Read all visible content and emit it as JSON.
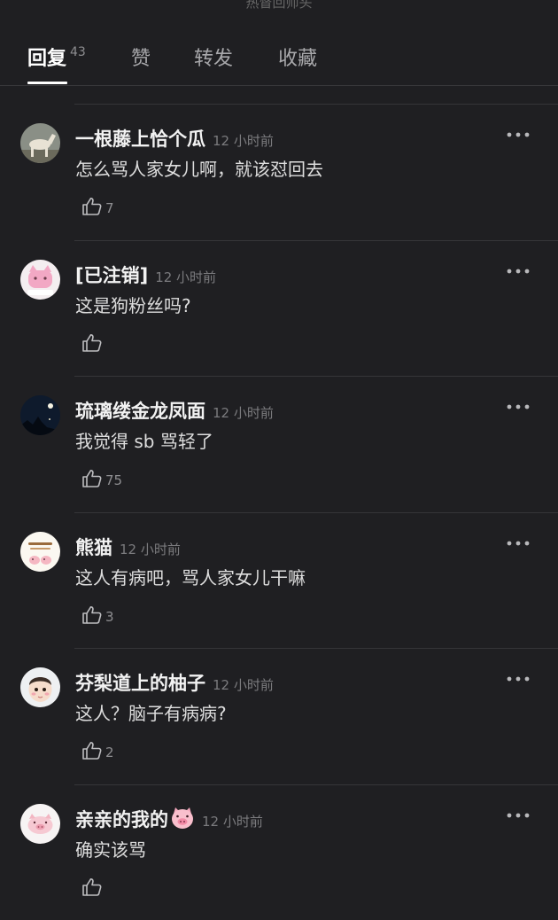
{
  "tabs": [
    {
      "label": "回复",
      "count": "43",
      "active": true
    },
    {
      "label": "赞"
    },
    {
      "label": "转发"
    },
    {
      "label": "收藏"
    }
  ],
  "top_partial_text": "热督回师头",
  "time_text": "12 小时前",
  "comments": [
    {
      "username": "一根藤上恰个瓜",
      "time": "12 小时前",
      "text": "怎么骂人家女儿啊，就该怼回去",
      "likes": "7",
      "avatar": "horse-avatar"
    },
    {
      "username": "[已注销]",
      "time": "12 小时前",
      "text": "这是狗粉丝吗?",
      "likes": "",
      "avatar": "pink-cat-avatar"
    },
    {
      "username": "琉璃缕金龙凤面",
      "time": "12 小时前",
      "text": "我觉得 sb 骂轻了",
      "likes": "75",
      "avatar": "night-moon-avatar"
    },
    {
      "username": "熊猫",
      "time": "12 小时前",
      "text": "这人有病吧，骂人家女儿干嘛",
      "likes": "3",
      "avatar": "cartoon-avatar"
    },
    {
      "username": "芬梨道上的柚子",
      "time": "12 小时前",
      "text": "这人？脑子有病病?",
      "likes": "2",
      "avatar": "baby-avatar"
    },
    {
      "username": "亲亲的我的",
      "time": "12 小时前",
      "text": "确实该骂",
      "likes": "",
      "avatar": "pig-avatar",
      "emoji": "pig-face-emoji"
    }
  ],
  "colors": {
    "background": "#1f1f22",
    "divider": "#353538",
    "secondary_text": "#7b7b7e"
  }
}
